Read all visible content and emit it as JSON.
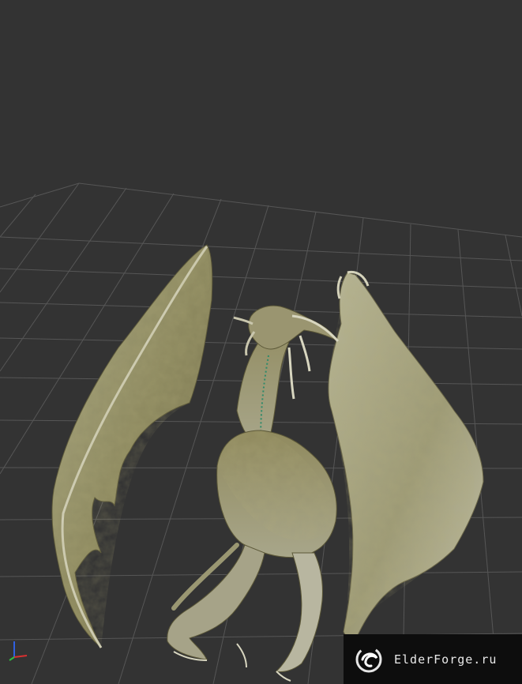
{
  "viewport": {
    "background": "#333333",
    "grid_color": "#5a5a5a",
    "model": "dragon"
  },
  "axis_gizmo": {
    "x_color": "#d83030",
    "y_color": "#30c040",
    "z_color": "#3060e0"
  },
  "watermark": {
    "text": "ElderForge.ru",
    "logo_icon": "elderforge-swirl-logo"
  }
}
